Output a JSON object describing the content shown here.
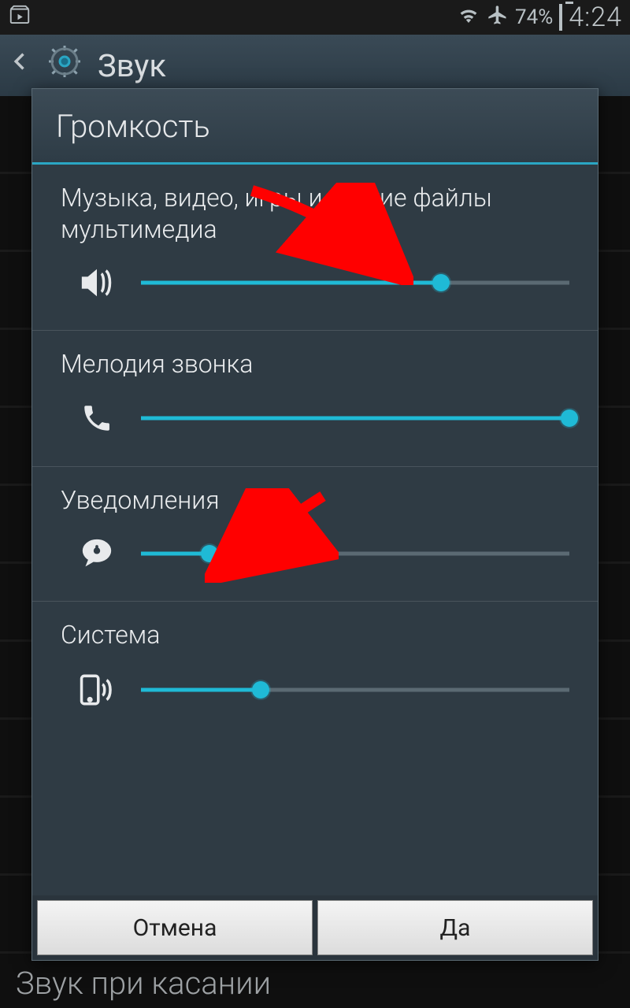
{
  "statusbar": {
    "battery_pct": "74%",
    "time": "4:24"
  },
  "background": {
    "screen_title": "Звук",
    "bottom_row_text": "Звук при касании"
  },
  "dialog": {
    "title": "Громкость",
    "sections": [
      {
        "label": "Музыка, видео, игры и другие файлы мультимедиа",
        "value_pct": 70,
        "icon": "speaker"
      },
      {
        "label": "Мелодия звонка",
        "value_pct": 100,
        "icon": "phone"
      },
      {
        "label": "Уведомления",
        "value_pct": 16,
        "icon": "bubble"
      },
      {
        "label": "Система",
        "value_pct": 28,
        "icon": "device"
      }
    ],
    "buttons": {
      "cancel": "Отмена",
      "ok": "Да"
    }
  },
  "accent_color": "#1fbad6"
}
